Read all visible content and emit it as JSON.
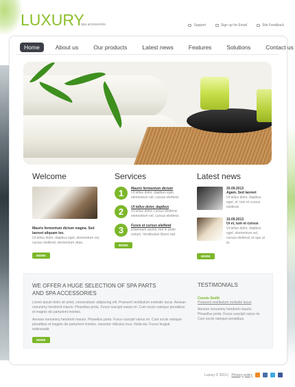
{
  "header": {
    "logo": "LUXURY",
    "tagline": "spa accessories",
    "links": [
      {
        "label": "Support",
        "icon": "support-icon"
      },
      {
        "label": "Sign up for Email",
        "icon": "mail-icon"
      },
      {
        "label": "Site Feedback",
        "icon": "feedback-icon"
      }
    ]
  },
  "nav": {
    "items": [
      "Home",
      "About us",
      "Our products",
      "Latest news",
      "Features",
      "Solutions",
      "Contact us"
    ],
    "active": "Home"
  },
  "welcome": {
    "title": "Welcome",
    "lead": "Mauris fermentum dictum magna. Sed laoreet aliquam leo.",
    "body": "Ut tellus dolor, dapibus eget, elementum vel, cursus eleifend, elementum vitae.",
    "button": "MORE"
  },
  "services": {
    "title": "Services",
    "items": [
      {
        "num": "1",
        "title": "Mauris fermentum dictum",
        "body": "Ut tellus dolor, dapibus eget, elementum vel, cursus eleifend."
      },
      {
        "num": "2",
        "title": "Ut tellus dolor, dapibus",
        "body": "Ut tellus dolor, cursus eleifend elementum vel, cursus eleifend."
      },
      {
        "num": "3",
        "title": "Fusce et cursus eleifend",
        "body": "Etiamnam auctor ved in pede rutrum. Vestibulum libero nisl."
      }
    ],
    "button": "MORE"
  },
  "news": {
    "title": "Latest news",
    "items": [
      {
        "date": "20.09.2013",
        "headline": "Agam. Sed laoreet",
        "body": "Ut tellus dolor, dapibus eget, el. tum et cursus eleifend."
      },
      {
        "date": "15.09.2013",
        "headline": "Ut et, tum et cursus",
        "body": "Ut tellus dolor, dapibus eget, elementum vel, cursus eleifend, et que ut la."
      }
    ],
    "button": "MORE"
  },
  "offer": {
    "title_line1": "WE OFFER A HUGE SELECTION OF SPA PARTS",
    "title_line2": "AND SPA ACCESSORIES",
    "para1": "Lorem ipsum dolor sit amet, consectetuer adipiscing elit. Praesent vestibulum molestie lacus. Aenean nonummy hendrerit mauris. Phasellus porta. Fusce suscipit varius mi. Cum sociis natoque penatibus et magnis dis parturient montes.",
    "para2": "Aenean nonummy hendrerit mauris. Phasellus porta. Fusce suscipit varius mi. Cum sociis natoque penatibus et magnis dis parturient montes, nascetur ridiculus mus. Nulla dui. Fusce feugiat malesuada",
    "button": "MORE"
  },
  "testimonials": {
    "title": "TESTIMONIALS",
    "name": "Connie Smith",
    "link": "Praesent vestibulum molestie lacus",
    "body": "Aenean nonummy hendrerit mauris. Phasellus porta. Fusce suscipit varius mi. Cum sociis natoque penatibus."
  },
  "footer": {
    "copyright": "Luxury © 2013 |",
    "privacy": "Privacy policy"
  }
}
